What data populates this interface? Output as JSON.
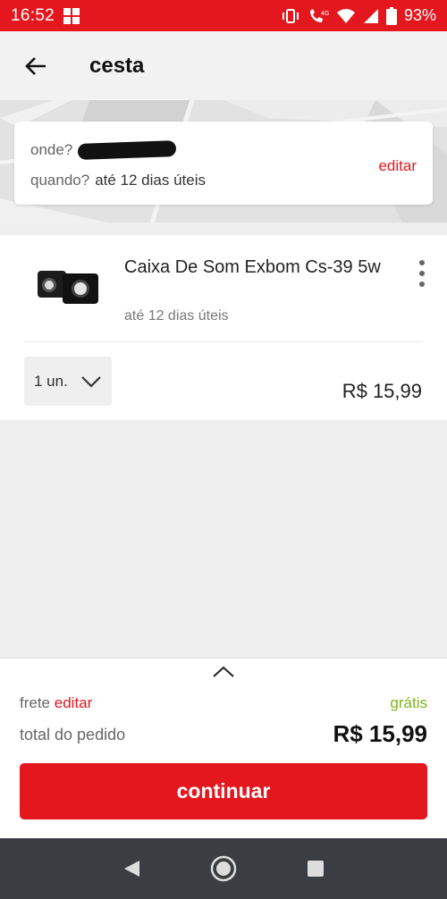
{
  "status_bar": {
    "time": "16:52",
    "battery": "93%",
    "network": "4G",
    "icons": [
      "windows-icon",
      "vibrate-icon",
      "wifi-calling-icon",
      "wifi-icon",
      "signal-icon",
      "battery-icon"
    ]
  },
  "app_bar": {
    "title": "cesta",
    "back_icon": "arrow-left-icon"
  },
  "delivery": {
    "where_label": "onde?",
    "when_label": "quando?",
    "when_value": "até 12 dias úteis",
    "edit_label": "editar"
  },
  "cart_item": {
    "title": "Caixa De Som Exbom Cs-39 5w",
    "eta": "até 12 dias úteis",
    "quantity": "1 un.",
    "price": "R$ 15,99",
    "more_icon": "more-vertical-icon"
  },
  "summary": {
    "shipping_label": "frete",
    "shipping_edit": "editar",
    "shipping_value": "grátis",
    "total_label": "total do pedido",
    "total_value": "R$ 15,99",
    "continue_label": "continuar"
  },
  "colors": {
    "brand_red": "#e4171e",
    "free_green": "#7cb518",
    "nav_bar": "#3a3d41"
  }
}
